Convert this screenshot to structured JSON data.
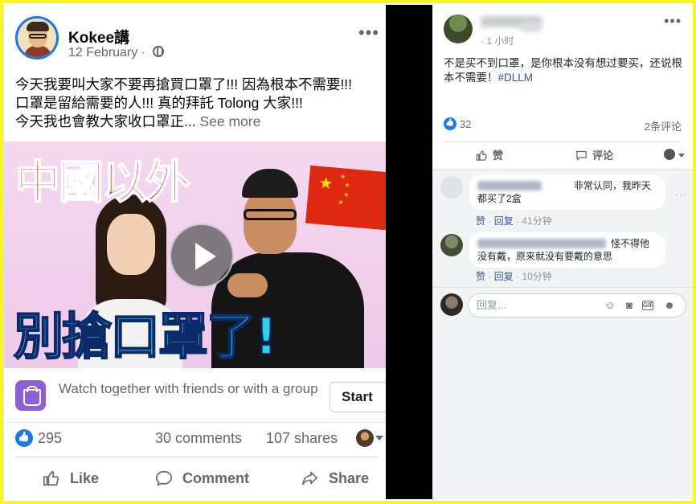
{
  "post": {
    "page_name": "Kokee講",
    "date": "12 February",
    "date_sep": "·",
    "text_line1": "今天我要叫大家不要再搶買口罩了!!! 因為根本不需要!!!",
    "text_line2": "口罩是留給需要的人!!! 真的拜託 Tolong 大家!!!",
    "text_line3": "今天我也會教大家收口罩正...",
    "see_more": "See more",
    "thumb_title_top": "中國以外",
    "thumb_title_bottom": "別搶口罩了!",
    "watch_text": "Watch together with friends or with a group",
    "start_label": "Start",
    "likes": "295",
    "comments": "30 comments",
    "shares": "107 shares",
    "actions": {
      "like": "Like",
      "comment": "Comment",
      "share": "Share"
    }
  },
  "side": {
    "time": "· 1 小时",
    "text": "不是买不到口罩，是你根本没有想过要买，还说根本不需要！",
    "tag": "#DLLM",
    "likes": "32",
    "comments": "2条评论",
    "actions": {
      "like": "赞",
      "comment": "评论"
    },
    "comment_list": [
      {
        "text": "非常认同，我昨天都买了2盒",
        "like": "赞",
        "reply": "回复",
        "time": "41分钟"
      },
      {
        "text": "怪不得他没有戴，原来就没有要戴的意思",
        "like": "赞",
        "reply": "回复",
        "time": "10分钟"
      }
    ],
    "reply_placeholder": "回复..."
  },
  "colors": {
    "accent": "#1877f2",
    "frame": "#ffff33",
    "divider": "#000000"
  }
}
